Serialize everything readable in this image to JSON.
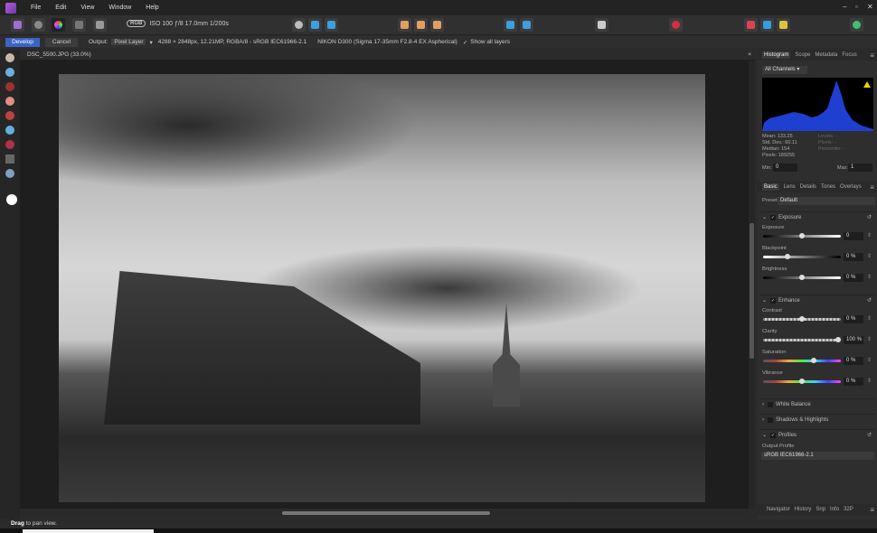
{
  "menu": {
    "items": [
      "File",
      "Edit",
      "View",
      "Window",
      "Help"
    ]
  },
  "window_controls": {
    "minimize": "–",
    "restore": "▫",
    "close": "✕"
  },
  "toolbar": {
    "rgb_badge": "RGB",
    "exif": "ISO 100 ƒ/8 17.0mm 1/200s"
  },
  "context": {
    "develop": "Develop",
    "cancel": "Cancel",
    "output_label": "Output:",
    "output_value": "Pixel Layer",
    "image_info": "4288 × 2848px, 12.21MP, RGBA/8 - sRGB IEC61966-2.1",
    "camera_info": "NIKON D300 (Sigma 17-35mm F2.8-4 EX Aspherical)",
    "show_all_layers": "Show all layers"
  },
  "document": {
    "tab": "DSC_5500.JPG (33.0%)",
    "close": "×"
  },
  "status": {
    "bold": "Drag",
    "rest": " to pan view."
  },
  "histogram_panel": {
    "tabs": [
      "Histogram",
      "Scope",
      "Metadata",
      "Focus"
    ],
    "channel": "All Channels",
    "stats": [
      "Mean: 133.25",
      "Std. Dev.: 60.11",
      "Median: 154",
      "Pixels: 189255"
    ],
    "stats_right": [
      "Levels: -",
      "Pixels: -",
      "Percentile: -"
    ],
    "min_label": "Min:",
    "min": "0",
    "max_label": "Max:",
    "max": "1",
    "colors": {
      "histogram": "#1f3fd0",
      "warning": "#f0d000"
    }
  },
  "adjust_panel": {
    "tabs": [
      "Basic",
      "Lens",
      "Details",
      "Tones",
      "Overlays"
    ],
    "preset_label": "Preset:",
    "preset": "Default",
    "sections": [
      {
        "title": "Exposure",
        "checked": true,
        "sliders": [
          {
            "label": "Exposure",
            "value": "0",
            "pos": 0.5
          },
          {
            "label": "Blackpoint",
            "value": "0 %",
            "pos": 0.3
          },
          {
            "label": "Brightness",
            "value": "0 %",
            "pos": 0.5
          }
        ]
      },
      {
        "title": "Enhance",
        "checked": true,
        "sliders": [
          {
            "label": "Contrast",
            "value": "0 %",
            "pos": 0.5
          },
          {
            "label": "Clarity",
            "value": "100 %",
            "pos": 1.0
          },
          {
            "label": "Saturation",
            "value": "0 %",
            "pos": 0.66
          },
          {
            "label": "Vibrance",
            "value": "0 %",
            "pos": 0.5
          }
        ]
      },
      {
        "title": "White Balance",
        "checked": false
      },
      {
        "title": "Shadows & Highlights",
        "checked": false
      },
      {
        "title": "Profiles",
        "checked": true
      }
    ],
    "output_profile_label": "Output Profile",
    "output_profile": "sRGB IEC61966-2.1"
  },
  "bottom_panel": {
    "tabs": [
      "Navigator",
      "History",
      "Snp",
      "Info",
      "32P"
    ]
  },
  "colors": {
    "accent": "#3a64c4"
  }
}
